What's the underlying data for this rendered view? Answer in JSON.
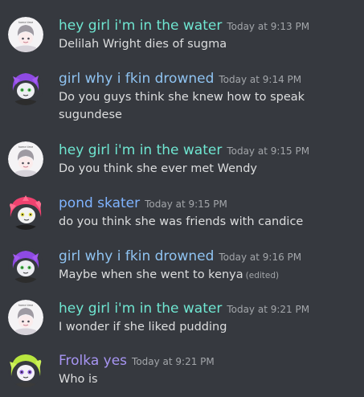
{
  "colors": {
    "background": "#36393f",
    "text": "#dcddde",
    "timestamp": "#a3a6aa",
    "user_water": "#6fe6d1",
    "user_drowned": "#8fc3f1",
    "user_pond": "#7fb3ff",
    "user_frolka": "#a795f3"
  },
  "messages": [
    {
      "username": "hey girl i'm in the water",
      "timestamp": "Today at 9:13 PM",
      "text": "Delilah Wright dies of sugma",
      "avatar": "white-cartoon-avatar",
      "avatar_caption": "home time"
    },
    {
      "username": "girl why i fkin drowned",
      "timestamp": "Today at 9:14 PM",
      "text": "Do you guys think she knew how to speak sugundese",
      "avatar": "purple-hair-avatar"
    },
    {
      "username": "hey girl i'm in the water",
      "timestamp": "Today at 9:15 PM",
      "text": "Do you think she ever met Wendy",
      "avatar": "white-cartoon-avatar",
      "avatar_caption": "home time"
    },
    {
      "username": "pond skater",
      "timestamp": "Today at 9:15 PM",
      "text": "do you think she was friends with candice",
      "avatar": "pink-hair-avatar"
    },
    {
      "username": "girl why i fkin drowned",
      "timestamp": "Today at 9:16 PM",
      "text": "Maybe when she went to kenya",
      "edited": "(edited)",
      "avatar": "purple-hair-avatar"
    },
    {
      "username": "hey girl i'm in the water",
      "timestamp": "Today at 9:21 PM",
      "text": "I wonder if she liked pudding",
      "avatar": "white-cartoon-avatar",
      "avatar_caption": "home time"
    },
    {
      "username": "Frolka yes",
      "timestamp": "Today at 9:21 PM",
      "text": "Who is",
      "avatar": "lime-hair-avatar"
    }
  ]
}
